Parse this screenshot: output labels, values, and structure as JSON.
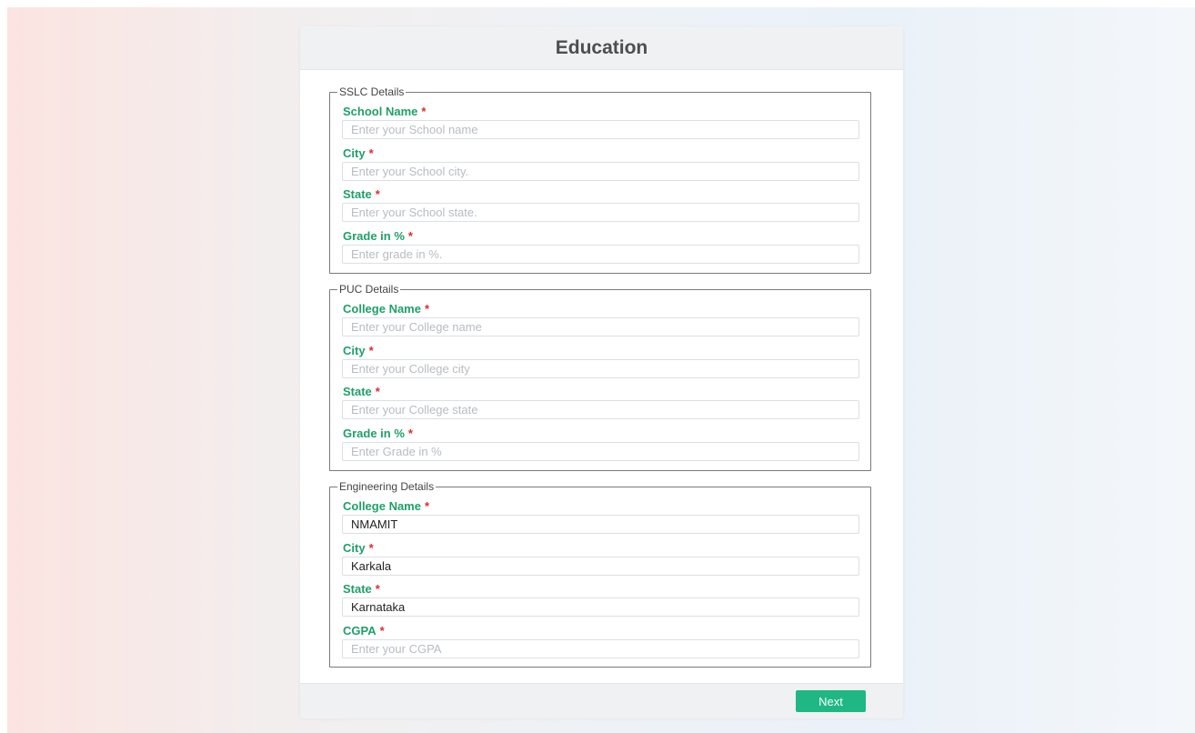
{
  "header": {
    "title": "Education"
  },
  "required_mark": "*",
  "sections": [
    {
      "legend": "SSLC Details",
      "fields": [
        {
          "label": "School Name",
          "placeholder": "Enter your School name",
          "value": ""
        },
        {
          "label": "City",
          "placeholder": "Enter your School city.",
          "value": ""
        },
        {
          "label": "State",
          "placeholder": "Enter your School state.",
          "value": ""
        },
        {
          "label": "Grade in %",
          "placeholder": "Enter grade in %.",
          "value": ""
        }
      ]
    },
    {
      "legend": "PUC Details",
      "fields": [
        {
          "label": "College Name",
          "placeholder": "Enter your College name",
          "value": ""
        },
        {
          "label": "City",
          "placeholder": "Enter your College city",
          "value": ""
        },
        {
          "label": "State",
          "placeholder": "Enter your College state",
          "value": ""
        },
        {
          "label": "Grade in %",
          "placeholder": "Enter Grade in %",
          "value": ""
        }
      ]
    },
    {
      "legend": "Engineering Details",
      "fields": [
        {
          "label": "College Name",
          "placeholder": "",
          "value": "NMAMIT"
        },
        {
          "label": "City",
          "placeholder": "",
          "value": "Karkala"
        },
        {
          "label": "State",
          "placeholder": "",
          "value": "Karnataka"
        },
        {
          "label": "CGPA",
          "placeholder": "Enter your CGPA",
          "value": ""
        }
      ]
    }
  ],
  "footer": {
    "next_label": "Next"
  },
  "colors": {
    "label": "#1fa06a",
    "required": "#e02b2b",
    "button": "#1fb784"
  }
}
